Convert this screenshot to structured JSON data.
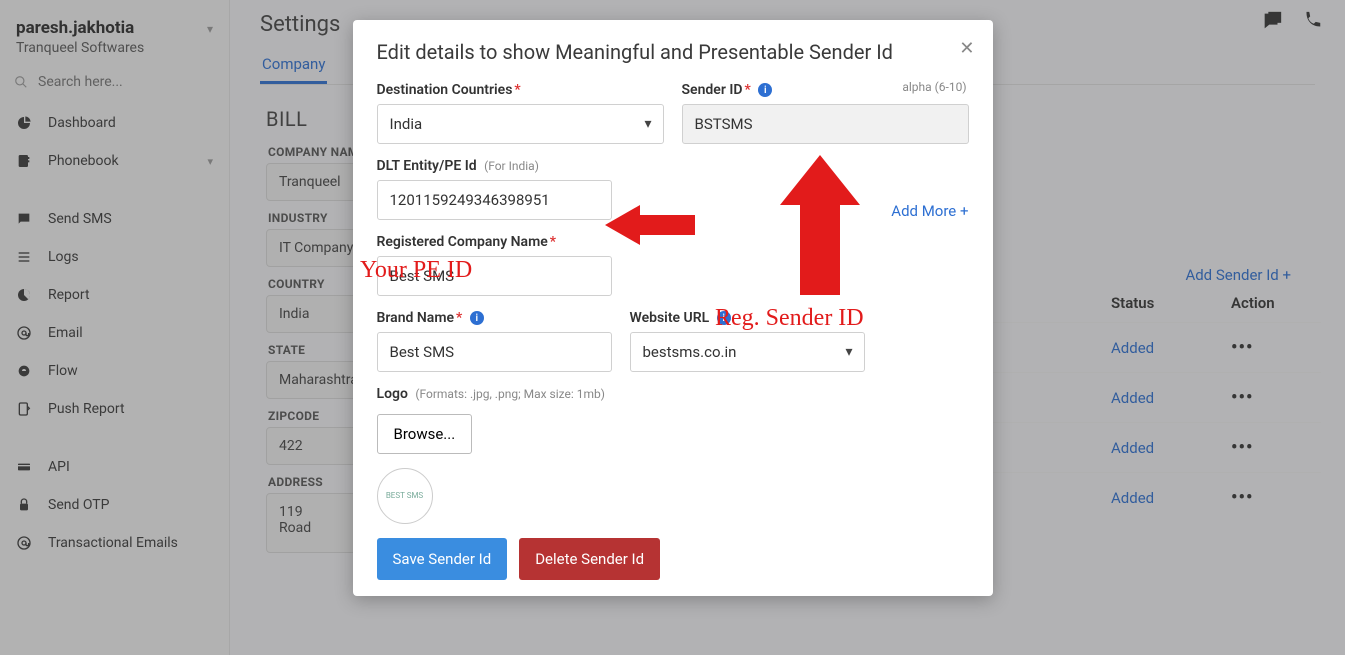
{
  "user": {
    "name": "paresh.jakhotia",
    "org": "Tranqueel Softwares"
  },
  "search": {
    "placeholder": "Search here..."
  },
  "nav": {
    "dashboard": "Dashboard",
    "phonebook": "Phonebook",
    "send_sms": "Send SMS",
    "logs": "Logs",
    "report": "Report",
    "email": "Email",
    "flow": "Flow",
    "push_report": "Push Report",
    "api": "API",
    "send_otp": "Send OTP",
    "transactional_emails": "Transactional Emails"
  },
  "page": {
    "title": "Settings",
    "tabs": {
      "company": "Company"
    },
    "section": "BILL",
    "labels": {
      "company_name": "COMPANY NAME",
      "industry": "INDUSTRY",
      "country": "COUNTRY",
      "state": "STATE",
      "zipcode": "ZIPCODE",
      "address": "ADDRESS"
    },
    "values": {
      "company_name": "Tranqueel",
      "industry": "IT Company",
      "country": "India",
      "state": "Maharashtra",
      "zipcode": "422",
      "address": "119\nRoad"
    },
    "add_sender_id": "Add Sender Id +",
    "table": {
      "col_status": "Status",
      "col_action": "Action",
      "rows": [
        {
          "status": "Added"
        },
        {
          "status": "Added"
        },
        {
          "status": "Added"
        },
        {
          "status": "Added"
        }
      ]
    }
  },
  "modal": {
    "title": "Edit details to show Meaningful and Presentable Sender Id",
    "labels": {
      "destination_countries": "Destination Countries",
      "sender_id": "Sender ID",
      "sender_hint": "alpha (6-10)",
      "dlt_entity": "DLT Entity/PE Id",
      "dlt_hint": "(For India)",
      "registered_company": "Registered Company Name",
      "brand_name": "Brand Name",
      "website_url": "Website URL",
      "logo": "Logo",
      "logo_hint": "(Formats: .jpg, .png; Max size: 1mb)",
      "add_more": "Add More +"
    },
    "values": {
      "destination_country": "India",
      "sender_id": "BSTSMS",
      "dlt_entity": "1201159249346398951",
      "registered_company": "Best SMS",
      "brand_name": "Best SMS",
      "website_url": "bestsms.co.in",
      "browse": "Browse...",
      "logo_text": "BEST SMS"
    },
    "buttons": {
      "save": "Save Sender Id",
      "delete": "Delete Sender Id"
    }
  },
  "annotations": {
    "pe_id": "Your PE ID",
    "sender_id": "Reg. Sender ID"
  }
}
